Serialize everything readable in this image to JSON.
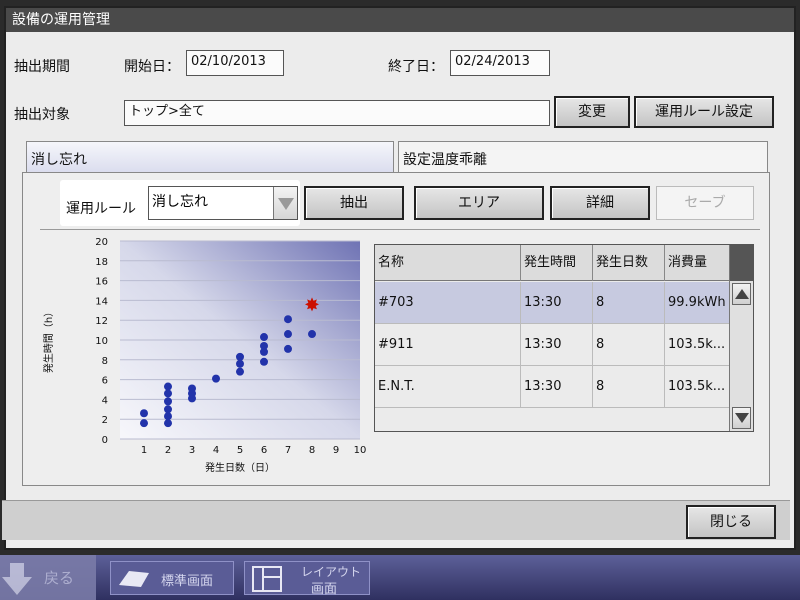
{
  "window": {
    "title": "設備の運用管理"
  },
  "period": {
    "label": "抽出期間",
    "start_label": "開始日：",
    "start_value": "02/10/2013",
    "end_label": "終了日：",
    "end_value": "02/24/2013"
  },
  "target": {
    "label": "抽出対象",
    "value": "トップ>全て",
    "change_button": "変更",
    "rule_button": "運用ルール設定"
  },
  "tabs": [
    {
      "label": "消し忘れ",
      "active": true
    },
    {
      "label": "設定温度乖離",
      "active": false
    }
  ],
  "toolbar": {
    "rule_label": "運用ルール",
    "rule_selected": "消し忘れ",
    "extract_button": "抽出",
    "area_button": "エリア",
    "detail_button": "詳細",
    "save_button": "セーブ"
  },
  "chart_data": {
    "type": "scatter",
    "xlabel": "発生日数（日）",
    "ylabel": "発生時間（h）",
    "xlim": [
      0,
      10
    ],
    "ylim": [
      0,
      20
    ],
    "xticks": [
      1,
      2,
      3,
      4,
      5,
      6,
      7,
      8,
      9,
      10
    ],
    "yticks": [
      0,
      2,
      4,
      6,
      8,
      10,
      12,
      14,
      16,
      18,
      20
    ],
    "grid": true,
    "series": [
      {
        "points": [
          [
            1,
            1.6
          ],
          [
            1,
            2.6
          ],
          [
            2,
            1.6
          ],
          [
            2,
            2.3
          ],
          [
            2,
            3.0
          ],
          [
            2,
            3.8
          ],
          [
            2,
            4.6
          ],
          [
            2,
            5.3
          ],
          [
            3,
            4.1
          ],
          [
            3,
            4.6
          ],
          [
            3,
            5.1
          ],
          [
            4,
            6.1
          ],
          [
            5,
            6.8
          ],
          [
            5,
            7.6
          ],
          [
            5,
            8.3
          ],
          [
            6,
            7.8
          ],
          [
            6,
            8.8
          ],
          [
            6,
            9.4
          ],
          [
            6,
            10.3
          ],
          [
            7,
            9.1
          ],
          [
            7,
            10.6
          ],
          [
            7,
            12.1
          ],
          [
            8,
            10.6
          ]
        ],
        "color": "#2233aa"
      },
      {
        "points": [
          [
            8,
            13.6
          ]
        ],
        "color": "#cc1100"
      }
    ]
  },
  "table": {
    "headers": [
      "名称",
      "発生時間",
      "発生日数",
      "消費量"
    ],
    "rows": [
      [
        "#703",
        "13:30",
        "8",
        "99.9kWh"
      ],
      [
        "#911",
        "13:30",
        "8",
        "103.5k..."
      ],
      [
        "E.N.T.",
        "13:30",
        "8",
        "103.5k..."
      ]
    ]
  },
  "footer": {
    "close_button": "閉じる"
  },
  "taskbar": {
    "back_label": "戻る",
    "standard_label": "標準画面",
    "layout_label_1": "レイアウト",
    "layout_label_2": "画面"
  }
}
